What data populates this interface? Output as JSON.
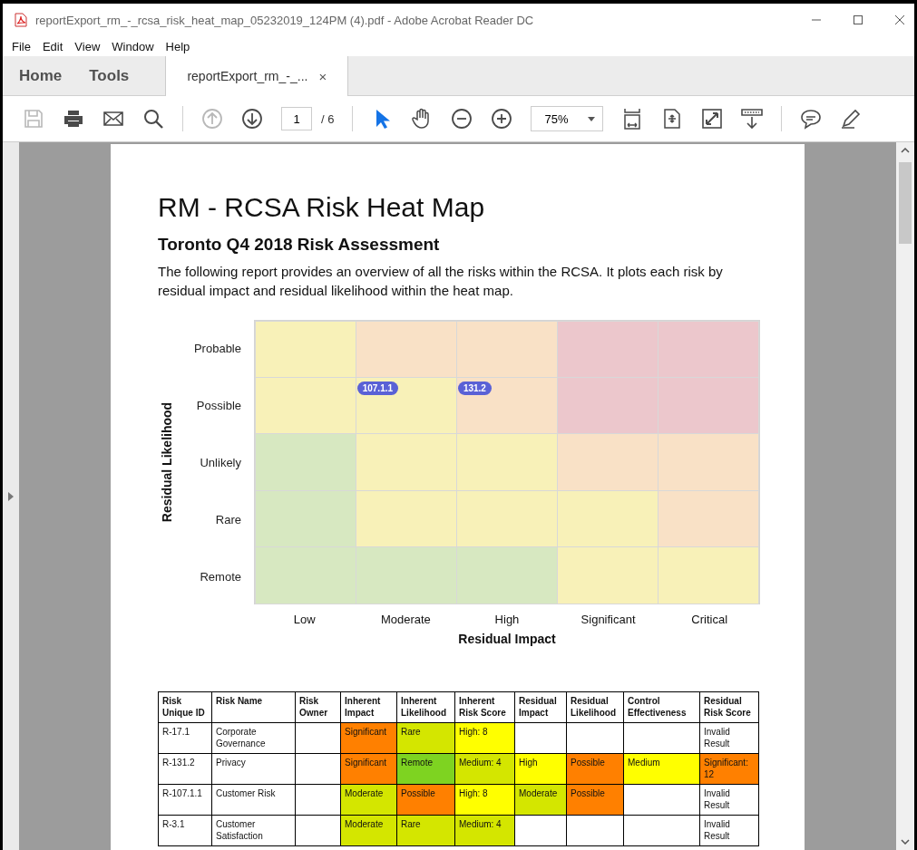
{
  "window": {
    "title": "reportExport_rm_-_rcsa_risk_heat_map_05232019_124PM (4).pdf - Adobe Acrobat Reader DC"
  },
  "menu": [
    "File",
    "Edit",
    "View",
    "Window",
    "Help"
  ],
  "nav_tabs": [
    {
      "label": "Home",
      "selected": false
    },
    {
      "label": "Tools",
      "selected": false
    }
  ],
  "document_tab": {
    "label": "reportExport_rm_-_...",
    "close": "×",
    "selected": true
  },
  "toolbar": {
    "groups": [
      [
        {
          "kind": "save",
          "disabled": true
        },
        {
          "kind": "print",
          "disabled": false
        },
        {
          "kind": "email",
          "disabled": false
        },
        {
          "kind": "search",
          "disabled": false
        }
      ],
      [
        {
          "kind": "previous_page",
          "disabled": true
        },
        {
          "kind": "next_page",
          "disabled": false
        },
        {
          "kind": "page_field",
          "value": "1",
          "total": "/ 6"
        }
      ],
      [
        {
          "kind": "select",
          "selected": true
        },
        {
          "kind": "hand",
          "selected": false
        },
        {
          "kind": "zoom_out",
          "disabled": false
        },
        {
          "kind": "zoom_in",
          "disabled": false
        },
        {
          "kind": "zoom_field",
          "value": "75%"
        },
        {
          "kind": "fit_page",
          "disabled": false
        },
        {
          "kind": "fit_width",
          "disabled": false
        },
        {
          "kind": "full_screen",
          "disabled": false
        },
        {
          "kind": "read_mode",
          "disabled": false
        }
      ],
      [
        {
          "kind": "comment",
          "disabled": false
        },
        {
          "kind": "highlight",
          "disabled": false
        }
      ]
    ]
  },
  "report": {
    "title": "RM - RCSA Risk Heat Map",
    "subtitle": "Toronto Q4 2018 Risk Assessment",
    "description": "The following report provides an overview of all the risks within the RCSA. It plots each risk by residual impact and residual likelihood within the heat map.",
    "heat_map": {
      "y_label": "Residual Likelihood",
      "x_label": "Residual Impact",
      "columns": [
        "Low",
        "Moderate",
        "High",
        "Significant",
        "Critical"
      ],
      "likelihood_levels": [
        {
          "label": "Probable",
          "cells": [
            {
              "color": "#f8f1b8"
            },
            {
              "color": "#f9e1c6"
            },
            {
              "color": "#f9e1c6"
            },
            {
              "color": "#ecc7cc"
            },
            {
              "color": "#ecc7cc"
            }
          ]
        },
        {
          "label": "Possible",
          "cells": [
            {
              "color": "#f8f1b8"
            },
            {
              "color": "#f8f1b8",
              "markers": [
                "107.1.1"
              ]
            },
            {
              "color": "#f9e1c6",
              "markers": [
                "131.2"
              ]
            },
            {
              "color": "#ecc7cc"
            },
            {
              "color": "#ecc7cc"
            }
          ]
        },
        {
          "label": "Unlikely",
          "cells": [
            {
              "color": "#d7e8c1"
            },
            {
              "color": "#f8f1b8"
            },
            {
              "color": "#f8f1b8"
            },
            {
              "color": "#f9e1c6"
            },
            {
              "color": "#f9e1c6"
            }
          ]
        },
        {
          "label": "Rare",
          "cells": [
            {
              "color": "#d7e8c1"
            },
            {
              "color": "#f8f1b8"
            },
            {
              "color": "#f8f1b8"
            },
            {
              "color": "#f8f1b8"
            },
            {
              "color": "#f9e1c6"
            }
          ]
        },
        {
          "label": "Remote",
          "cells": [
            {
              "color": "#d7e8c1"
            },
            {
              "color": "#d7e8c1"
            },
            {
              "color": "#d7e8c1"
            },
            {
              "color": "#f8f1b8"
            },
            {
              "color": "#f8f1b8"
            }
          ]
        }
      ]
    },
    "table": {
      "columns": [
        "Risk Unique ID",
        "Risk Name",
        "Risk Owner",
        "Inherent Impact",
        "Inherent Likelihood",
        "Inherent Risk Score",
        "Residual Impact",
        "Residual Likelihood",
        "Control Effectiveness",
        "Residual Risk Score"
      ],
      "rows": [
        {
          "cells": [
            {
              "text": "R-17.1"
            },
            {
              "text": "Corporate Governance"
            },
            {},
            {
              "text": "Significant",
              "color": "#ff8000"
            },
            {
              "text": "Rare",
              "color": "#d4e600"
            },
            {
              "text": "High: 8",
              "color": "#ffff00"
            },
            {},
            {},
            {},
            {
              "text": "Invalid Result"
            }
          ]
        },
        {
          "cells": [
            {
              "text": "R-131.2"
            },
            {
              "text": "Privacy"
            },
            {},
            {
              "text": "Significant",
              "color": "#ff8000"
            },
            {
              "text": "Remote",
              "color": "#7ed321"
            },
            {
              "text": "Medium: 4",
              "color": "#d4e600"
            },
            {
              "text": "High",
              "color": "#ffff00"
            },
            {
              "text": "Possible",
              "color": "#ff8000"
            },
            {
              "text": "Medium",
              "color": "#ffff00"
            },
            {
              "text": "Significant: 12",
              "color": "#ff8000"
            }
          ]
        },
        {
          "cells": [
            {
              "text": "R-107.1.1"
            },
            {
              "text": "Customer Risk"
            },
            {},
            {
              "text": "Moderate",
              "color": "#d4e600"
            },
            {
              "text": "Possible",
              "color": "#ff8000"
            },
            {
              "text": "High: 8",
              "color": "#ffff00"
            },
            {
              "text": "Moderate",
              "color": "#d4e600"
            },
            {
              "text": "Possible",
              "color": "#ff8000"
            },
            {},
            {
              "text": "Invalid Result"
            }
          ]
        },
        {
          "cells": [
            {
              "text": "R-3.1"
            },
            {
              "text": "Customer Satisfaction"
            },
            {},
            {
              "text": "Moderate",
              "color": "#d4e600"
            },
            {
              "text": "Rare",
              "color": "#d4e600"
            },
            {
              "text": "Medium: 4",
              "color": "#d4e600"
            },
            {},
            {},
            {},
            {
              "text": "Invalid Result"
            }
          ]
        }
      ]
    }
  }
}
